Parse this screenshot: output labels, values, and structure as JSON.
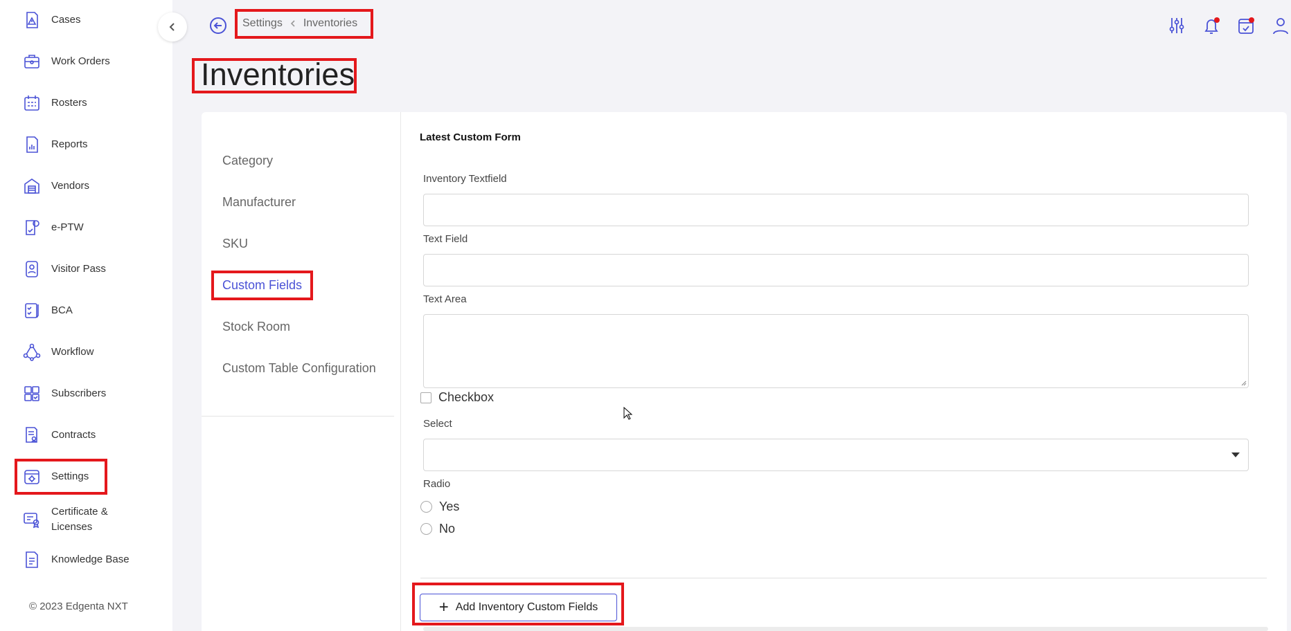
{
  "sidebar": {
    "items": [
      {
        "label": "Cases",
        "icon": "cases-icon"
      },
      {
        "label": "Work Orders",
        "icon": "work-orders-icon"
      },
      {
        "label": "Rosters",
        "icon": "rosters-icon"
      },
      {
        "label": "Reports",
        "icon": "reports-icon"
      },
      {
        "label": "Vendors",
        "icon": "vendors-icon"
      },
      {
        "label": "e-PTW",
        "icon": "eptw-icon"
      },
      {
        "label": "Visitor Pass",
        "icon": "visitor-pass-icon"
      },
      {
        "label": "BCA",
        "icon": "bca-icon"
      },
      {
        "label": "Workflow",
        "icon": "workflow-icon"
      },
      {
        "label": "Subscribers",
        "icon": "subscribers-icon"
      },
      {
        "label": "Contracts",
        "icon": "contracts-icon"
      },
      {
        "label": "Settings",
        "icon": "settings-icon"
      },
      {
        "label": "Certificate & Licenses",
        "icon": "certificate-icon"
      },
      {
        "label": "Knowledge Base",
        "icon": "knowledge-base-icon"
      }
    ],
    "copyright": "© 2023 Edgenta NXT"
  },
  "breadcrumb": {
    "parent": "Settings",
    "current": "Inventories"
  },
  "page_title": "Inventories",
  "tabs": [
    {
      "label": "Category"
    },
    {
      "label": "Manufacturer"
    },
    {
      "label": "SKU"
    },
    {
      "label": "Custom Fields"
    },
    {
      "label": "Stock Room"
    },
    {
      "label": "Custom Table Configuration"
    }
  ],
  "form": {
    "title": "Latest Custom Form",
    "inventory_textfield_label": "Inventory Textfield",
    "text_field_label": "Text Field",
    "text_area_label": "Text Area",
    "checkbox_label": "Checkbox",
    "select_label": "Select",
    "radio_label": "Radio",
    "radio_options": [
      {
        "label": "Yes"
      },
      {
        "label": "No"
      }
    ],
    "add_button_label": "Add Inventory Custom Fields"
  },
  "colors": {
    "accent": "#4a52d6",
    "highlight": "#e4181c",
    "notification_dot": "#e4181c"
  }
}
